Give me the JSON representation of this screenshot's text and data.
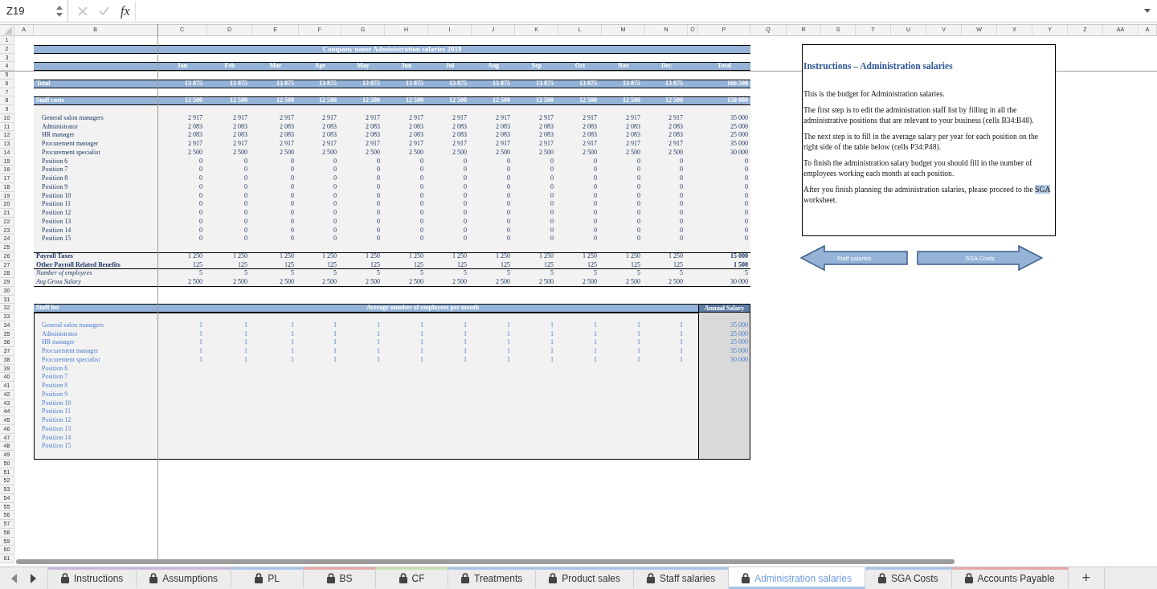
{
  "formula_bar": {
    "name_box": "Z19",
    "function_label": "fx"
  },
  "column_headers": [
    "A",
    "B",
    "C",
    "D",
    "E",
    "F",
    "G",
    "H",
    "I",
    "J",
    "K",
    "L",
    "M",
    "N",
    "O",
    "P",
    "Q",
    "R",
    "S",
    "T",
    "U",
    "V",
    "W",
    "X",
    "Y",
    "Z",
    "AA",
    "A"
  ],
  "row_numbers": [
    "1",
    "2",
    "3",
    "4",
    "5",
    "6",
    "7",
    "8",
    "9",
    "10",
    "11",
    "12",
    "13",
    "14",
    "15",
    "16",
    "17",
    "18",
    "19",
    "20",
    "21",
    "22",
    "23",
    "24",
    "25",
    "26",
    "27",
    "28",
    "29",
    "30",
    "31",
    "32",
    "33",
    "34",
    "35",
    "36",
    "37",
    "38",
    "39",
    "40",
    "41",
    "42",
    "43",
    "44",
    "45",
    "46",
    "47",
    "48",
    "49",
    "50",
    "51",
    "52",
    "53",
    "54",
    "55",
    "56",
    "57",
    "58",
    "59",
    "60",
    "61"
  ],
  "sheet": {
    "title": "Company name Administration salaries 2018",
    "months": [
      "Jan",
      "Feb",
      "Mar",
      "Apr",
      "May",
      "Jun",
      "Jul",
      "Aug",
      "Sep",
      "Oct",
      "Nov",
      "Dec",
      "Total"
    ],
    "summary_rows": [
      {
        "label": "Total",
        "values": [
          "13 875",
          "13 875",
          "13 875",
          "13 875",
          "13 875",
          "13 875",
          "13 875",
          "13 875",
          "13 875",
          "13 875",
          "13 875",
          "13 875",
          "166 500"
        ]
      },
      {
        "label": "Staff costs",
        "values": [
          "12 500",
          "12 500",
          "12 500",
          "12 500",
          "12 500",
          "12 500",
          "12 500",
          "12 500",
          "12 500",
          "12 500",
          "12 500",
          "12 500",
          "150 000"
        ]
      }
    ],
    "positions": [
      {
        "label": "General salon managers",
        "values": [
          "2 917",
          "2 917",
          "2 917",
          "2 917",
          "2 917",
          "2 917",
          "2 917",
          "2 917",
          "2 917",
          "2 917",
          "2 917",
          "2 917",
          "35 000"
        ]
      },
      {
        "label": "Administrator",
        "values": [
          "2 083",
          "2 083",
          "2 083",
          "2 083",
          "2 083",
          "2 083",
          "2 083",
          "2 083",
          "2 083",
          "2 083",
          "2 083",
          "2 083",
          "25 000"
        ]
      },
      {
        "label": "HR manager",
        "values": [
          "2 083",
          "2 083",
          "2 083",
          "2 083",
          "2 083",
          "2 083",
          "2 083",
          "2 083",
          "2 083",
          "2 083",
          "2 083",
          "2 083",
          "25 000"
        ]
      },
      {
        "label": "Procurement manager",
        "values": [
          "2 917",
          "2 917",
          "2 917",
          "2 917",
          "2 917",
          "2 917",
          "2 917",
          "2 917",
          "2 917",
          "2 917",
          "2 917",
          "2 917",
          "35 000"
        ]
      },
      {
        "label": "Procurement specialist",
        "values": [
          "2 500",
          "2 500",
          "2 500",
          "2 500",
          "2 500",
          "2 500",
          "2 500",
          "2 500",
          "2 500",
          "2 500",
          "2 500",
          "2 500",
          "30 000"
        ]
      },
      {
        "label": "Position 6",
        "values": [
          "0",
          "0",
          "0",
          "0",
          "0",
          "0",
          "0",
          "0",
          "0",
          "0",
          "0",
          "0",
          "0"
        ]
      },
      {
        "label": "Position 7",
        "values": [
          "0",
          "0",
          "0",
          "0",
          "0",
          "0",
          "0",
          "0",
          "0",
          "0",
          "0",
          "0",
          "0"
        ]
      },
      {
        "label": "Position 8",
        "values": [
          "0",
          "0",
          "0",
          "0",
          "0",
          "0",
          "0",
          "0",
          "0",
          "0",
          "0",
          "0",
          "0"
        ]
      },
      {
        "label": "Position 9",
        "values": [
          "0",
          "0",
          "0",
          "0",
          "0",
          "0",
          "0",
          "0",
          "0",
          "0",
          "0",
          "0",
          "0"
        ]
      },
      {
        "label": "Position 10",
        "values": [
          "0",
          "0",
          "0",
          "0",
          "0",
          "0",
          "0",
          "0",
          "0",
          "0",
          "0",
          "0",
          "0"
        ]
      },
      {
        "label": "Position 11",
        "values": [
          "0",
          "0",
          "0",
          "0",
          "0",
          "0",
          "0",
          "0",
          "0",
          "0",
          "0",
          "0",
          "0"
        ]
      },
      {
        "label": "Position 12",
        "values": [
          "0",
          "0",
          "0",
          "0",
          "0",
          "0",
          "0",
          "0",
          "0",
          "0",
          "0",
          "0",
          "0"
        ]
      },
      {
        "label": "Position 13",
        "values": [
          "0",
          "0",
          "0",
          "0",
          "0",
          "0",
          "0",
          "0",
          "0",
          "0",
          "0",
          "0",
          "0"
        ]
      },
      {
        "label": "Position 14",
        "values": [
          "0",
          "0",
          "0",
          "0",
          "0",
          "0",
          "0",
          "0",
          "0",
          "0",
          "0",
          "0",
          "0"
        ]
      },
      {
        "label": "Position 15",
        "values": [
          "0",
          "0",
          "0",
          "0",
          "0",
          "0",
          "0",
          "0",
          "0",
          "0",
          "0",
          "0",
          "0"
        ]
      }
    ],
    "footer_rows": [
      {
        "label": "Payroll Taxes",
        "kind": "bold",
        "values": [
          "1 250",
          "1 250",
          "1 250",
          "1 250",
          "1 250",
          "1 250",
          "1 250",
          "1 250",
          "1 250",
          "1 250",
          "1 250",
          "1 250",
          "15 000"
        ]
      },
      {
        "label": "Other Payroll Related Benefits",
        "kind": "bold",
        "values": [
          "125",
          "125",
          "125",
          "125",
          "125",
          "125",
          "125",
          "125",
          "125",
          "125",
          "125",
          "125",
          "1 500"
        ]
      },
      {
        "label": "Number of employees",
        "kind": "italic",
        "values": [
          "5",
          "5",
          "5",
          "5",
          "5",
          "5",
          "5",
          "5",
          "5",
          "5",
          "5",
          "5",
          "5"
        ]
      },
      {
        "label": "Avg Gross Salary",
        "kind": "italic",
        "values": [
          "2 500",
          "2 500",
          "2 500",
          "2 500",
          "2 500",
          "2 500",
          "2 500",
          "2 500",
          "2 500",
          "2 500",
          "2 500",
          "2 500",
          "30 000"
        ]
      }
    ],
    "staff_list": {
      "title": "Staff list",
      "months_label": "Average number of employees per month",
      "salary_label": "Annual Salary",
      "rows": [
        {
          "label": "General salon managers",
          "counts": [
            "1",
            "1",
            "1",
            "1",
            "1",
            "1",
            "1",
            "1",
            "1",
            "1",
            "1",
            "1"
          ],
          "annual_salary": "35 000"
        },
        {
          "label": "Administrator",
          "counts": [
            "1",
            "1",
            "1",
            "1",
            "1",
            "1",
            "1",
            "1",
            "1",
            "1",
            "1",
            "1"
          ],
          "annual_salary": "25 000"
        },
        {
          "label": "HR manager",
          "counts": [
            "1",
            "1",
            "1",
            "1",
            "1",
            "1",
            "1",
            "1",
            "1",
            "1",
            "1",
            "1"
          ],
          "annual_salary": "25 000"
        },
        {
          "label": "Procurement manager",
          "counts": [
            "1",
            "1",
            "1",
            "1",
            "1",
            "1",
            "1",
            "1",
            "1",
            "1",
            "1",
            "1"
          ],
          "annual_salary": "35 000"
        },
        {
          "label": "Procurement specialist",
          "counts": [
            "1",
            "1",
            "1",
            "1",
            "1",
            "1",
            "1",
            "1",
            "1",
            "1",
            "1",
            "1"
          ],
          "annual_salary": "30 000"
        },
        {
          "label": "Position 6"
        },
        {
          "label": "Position 7"
        },
        {
          "label": "Position 8"
        },
        {
          "label": "Position 9"
        },
        {
          "label": "Position 10"
        },
        {
          "label": "Position 11"
        },
        {
          "label": "Position 12"
        },
        {
          "label": "Position 13"
        },
        {
          "label": "Position 14"
        },
        {
          "label": "Position 15"
        }
      ]
    }
  },
  "instructions": {
    "title": "Instructions – Administration salaries",
    "paragraphs": [
      [
        {
          "text": "This is the budget for Administration salaries.",
          "highlighted": false
        }
      ],
      [
        {
          "text": "The first step is to edit the administration staff list by filling in all the administrative positions that are relevant to your business (cells B34:B48).",
          "highlighted": false
        }
      ],
      [
        {
          "text": "The next step is to fill in the average salary per year for each position on the right side of the table below (cells P34:P48).",
          "highlighted": false
        }
      ],
      [
        {
          "text": "To finish the administration salary budget you should fill in the number of employees working each month at each position.",
          "highlighted": false
        }
      ],
      [
        {
          "text": "After you finish planning the administration salaries, please proceed to the ",
          "highlighted": false
        },
        {
          "text": "SGA",
          "highlighted": true
        },
        {
          "text": " worksheet.",
          "highlighted": false
        }
      ]
    ]
  },
  "nav_buttons": [
    {
      "label": "Staff salaries",
      "kind": "left"
    },
    {
      "label": "SGA Costs",
      "kind": "right"
    }
  ],
  "tabs": [
    {
      "label": "Instructions",
      "selected": false,
      "color": "#c8b7dc"
    },
    {
      "label": "Assumptions",
      "selected": false,
      "color": "#c8b7dc"
    },
    {
      "label": "PL",
      "selected": false,
      "color": "#a8c3e6"
    },
    {
      "label": "BS",
      "selected": false,
      "color": "#e6a8a8"
    },
    {
      "label": "CF",
      "selected": false,
      "color": "#c7e0b3"
    },
    {
      "label": "Treatments",
      "selected": false,
      "color": "#a8c3e6"
    },
    {
      "label": "Product sales",
      "selected": false,
      "color": "#a8c3e6"
    },
    {
      "label": "Staff salaries",
      "selected": false,
      "color": "#a8c3e6"
    },
    {
      "label": "Administration salaries",
      "selected": true,
      "color": "#a8c3e6"
    },
    {
      "label": "SGA Costs",
      "selected": false,
      "color": "#a8c3e6"
    },
    {
      "label": "Accounts Payable",
      "selected": false,
      "color": "#e6a8a8"
    }
  ],
  "add_sheet_label": "+"
}
